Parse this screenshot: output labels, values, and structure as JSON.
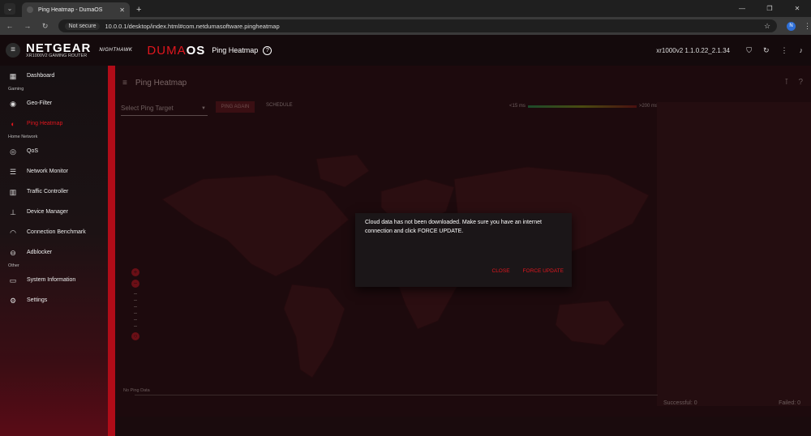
{
  "browser": {
    "tab_title": "Ping Heatmap - DumaOS",
    "tab_close": "✕",
    "new_tab": "+",
    "security_label": "Not secure",
    "url": "10.0.0.1/desktop/index.html#com.netdumasoftware.pingheatmap",
    "profile_initial": "N"
  },
  "header": {
    "brand": "NETGEAR",
    "brand_sub": "XR1000V2 GAMING ROUTER",
    "nighthawk": "NIGHTHAWK",
    "duma_a": "DUMA",
    "duma_b": "OS",
    "title": "Ping Heatmap",
    "version": "xr1000v2 1.1.0.22_2.1.34"
  },
  "sidebar": {
    "items": [
      {
        "label": "Dashboard",
        "icon": "dashboard-icon"
      },
      {
        "group": "Gaming"
      },
      {
        "label": "Geo-Filter",
        "icon": "geo-filter-icon"
      },
      {
        "label": "Ping Heatmap",
        "icon": "ping-heatmap-icon",
        "active": true
      },
      {
        "group": "Home Network"
      },
      {
        "label": "QoS",
        "icon": "qos-icon"
      },
      {
        "label": "Network Monitor",
        "icon": "network-monitor-icon"
      },
      {
        "label": "Traffic Controller",
        "icon": "traffic-controller-icon"
      },
      {
        "label": "Device Manager",
        "icon": "device-manager-icon"
      },
      {
        "label": "Connection Benchmark",
        "icon": "benchmark-icon"
      },
      {
        "label": "Adblocker",
        "icon": "adblocker-icon"
      },
      {
        "group": "Other"
      },
      {
        "label": "System Information",
        "icon": "system-info-icon"
      },
      {
        "label": "Settings",
        "icon": "settings-icon"
      }
    ]
  },
  "main": {
    "title": "Ping Heatmap",
    "target_placeholder": "Select Ping Target",
    "ping_again": "PING AGAIN",
    "schedule": "SCHEDULE",
    "legend_min": "<15 ms",
    "legend_max": ">200 ms",
    "no_ping": "No Ping Data",
    "successful": "Successful: 0",
    "failed": "Failed: 0"
  },
  "dialog": {
    "message": "Cloud data has not been downloaded. Make sure you have an internet connection and click FORCE UPDATE.",
    "close": "CLOSE",
    "force_update": "FORCE UPDATE"
  },
  "colors": {
    "accent": "#e0161e",
    "sidebar_bar": "#b00c18"
  }
}
